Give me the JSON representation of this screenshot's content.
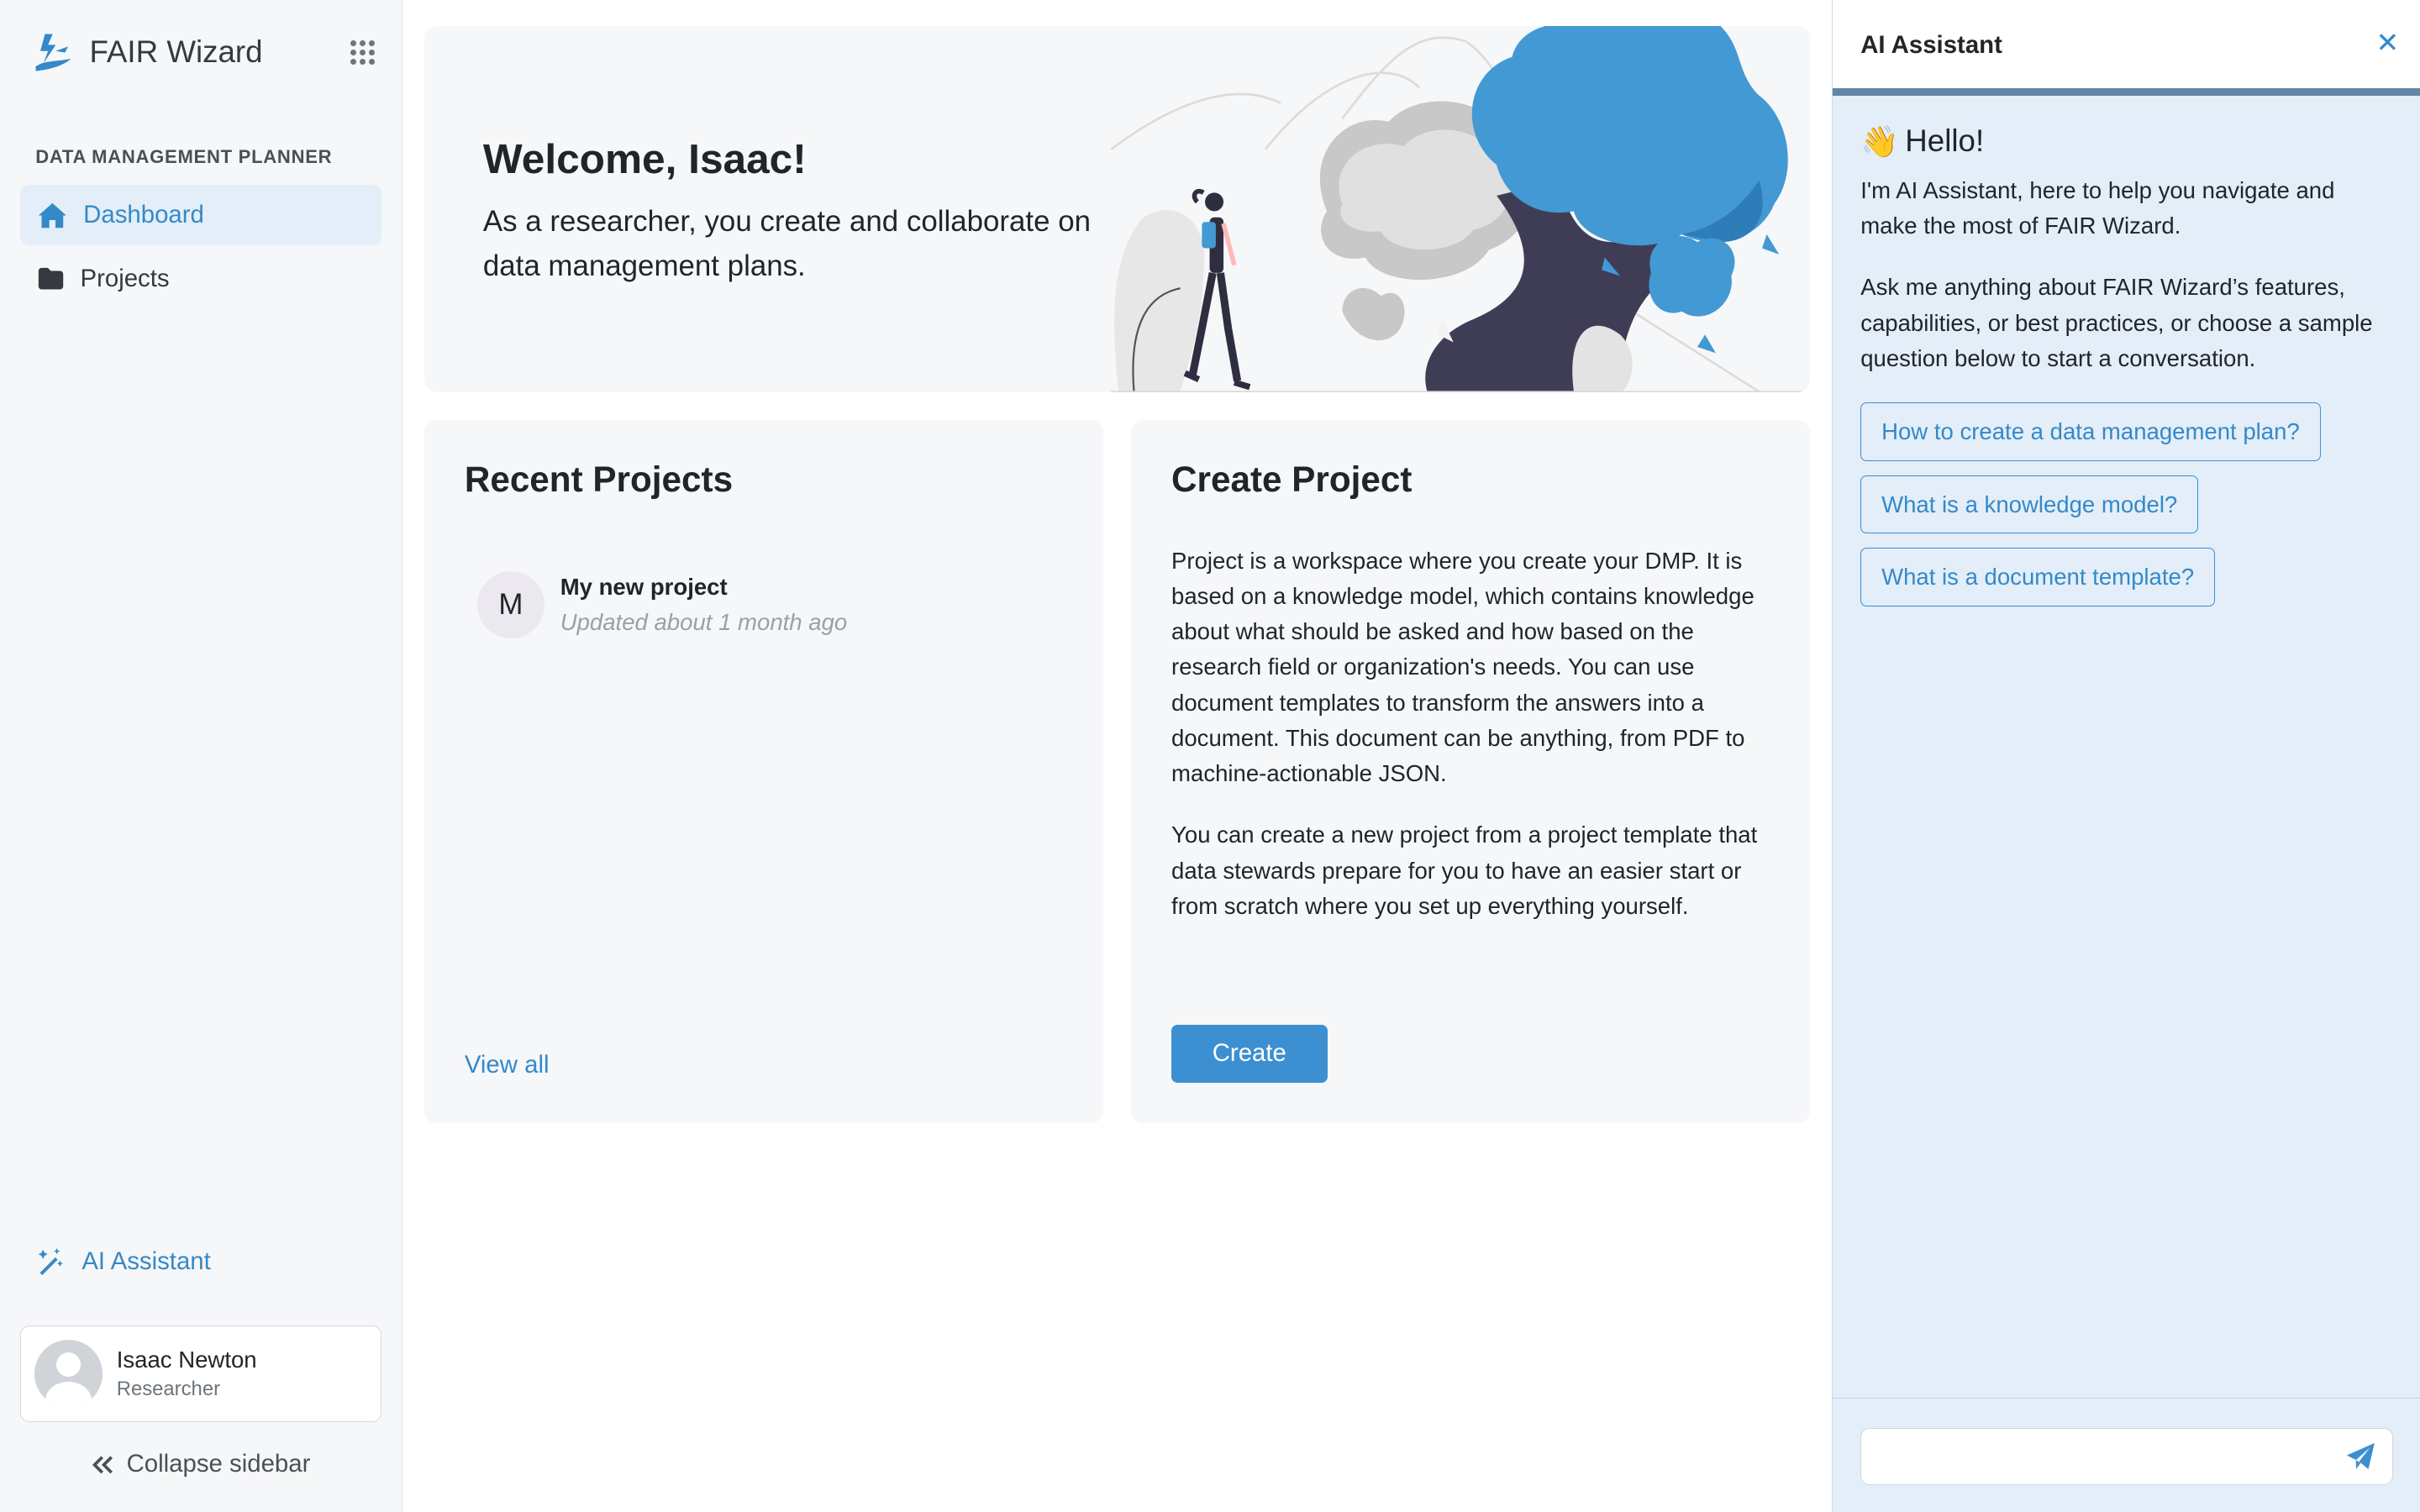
{
  "app": {
    "name": "FAIR Wizard",
    "accent_color": "#3c8fd0",
    "logo_icon": "wizard-logo-icon",
    "apps_menu_icon": "grid-dots-icon"
  },
  "sidebar": {
    "section_title": "DATA MANAGEMENT PLANNER",
    "items": [
      {
        "label": "Dashboard",
        "icon": "home-icon",
        "active": true
      },
      {
        "label": "Projects",
        "icon": "folder-icon",
        "active": false
      }
    ],
    "ai_assistant_label": "AI Assistant",
    "ai_assistant_icon": "magic-wand-icon",
    "user": {
      "name": "Isaac Newton",
      "role": "Researcher"
    },
    "collapse_label": "Collapse sidebar"
  },
  "hero": {
    "title": "Welcome, Isaac!",
    "subtitle": "As a researcher, you create and collaborate on data management plans."
  },
  "recent_projects": {
    "title": "Recent Projects",
    "items": [
      {
        "initial": "M",
        "name": "My new project",
        "updated": "Updated about 1 month ago"
      }
    ],
    "view_all_label": "View all"
  },
  "create_project": {
    "title": "Create Project",
    "paragraphs": [
      "Project is a workspace where you create your DMP. It is based on a knowledge model, which contains knowledge about what should be asked and how based on the research field or organization's needs. You can use document templates to transform the answers into a document. This document can be anything, from PDF to machine-actionable JSON.",
      "You can create a new project from a project template that data stewards prepare for you to have an easier start or from scratch where you set up everything yourself."
    ],
    "button_label": "Create"
  },
  "ai_panel": {
    "title": "AI Assistant",
    "close_icon": "close-icon",
    "greeting_emoji": "👋",
    "greeting": "Hello!",
    "intro": "I'm AI Assistant, here to help you navigate and make the most of FAIR Wizard.",
    "prompt": "Ask me anything about FAIR Wizard’s features, capabilities, or best practices, or choose a sample question below to start a conversation.",
    "suggestions": [
      "How to create a data management plan?",
      "What is a knowledge model?",
      "What is a document template?"
    ],
    "input_value": "",
    "send_icon": "paper-plane-icon",
    "progress": 1.0
  }
}
